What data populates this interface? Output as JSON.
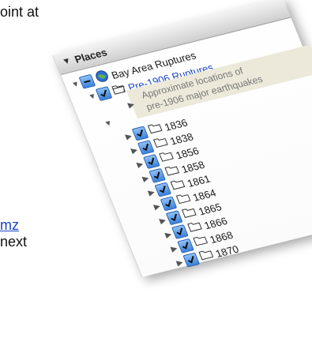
{
  "background_text": {
    "line1": "oint at",
    "line2": "mz",
    "line3": "next"
  },
  "places": {
    "header": "Places",
    "root": "Bay Area Ruptures",
    "folder": "Pre-1906 Ruptures",
    "description_line1": "Approximate locations of",
    "description_line2": "pre-1906 major earthquakes",
    "years": [
      "1836",
      "1838",
      "1856",
      "1858",
      "1861",
      "1864",
      "1865",
      "1866",
      "1868",
      "1870"
    ]
  },
  "colors": {
    "link": "#1a44c8",
    "checkbox": "#3b82dc",
    "description_band": "#ece9da"
  },
  "icons": {
    "disclosure": "triangle-icon",
    "checkbox": "checkmark-icon",
    "globe": "globe-icon",
    "folder": "folder-icon"
  }
}
